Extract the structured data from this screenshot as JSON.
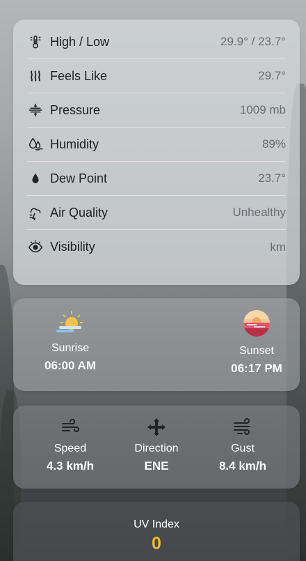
{
  "details": [
    {
      "icon": "thermometer-icon",
      "label": "High / Low",
      "value": "29.9° / 23.7°"
    },
    {
      "icon": "heat-waves-icon",
      "label": "Feels Like",
      "value": "29.7°"
    },
    {
      "icon": "pressure-icon",
      "label": "Pressure",
      "value": "1009 mb"
    },
    {
      "icon": "humidity-icon",
      "label": "Humidity",
      "value": "89%"
    },
    {
      "icon": "droplet-icon",
      "label": "Dew Point",
      "value": "23.7°"
    },
    {
      "icon": "air-quality-icon",
      "label": "Air Quality",
      "value": "Unhealthy"
    },
    {
      "icon": "eye-icon",
      "label": "Visibility",
      "value": "km"
    }
  ],
  "sun": {
    "sunrise_label": "Sunrise",
    "sunrise_time": "06:00 AM",
    "sunset_label": "Sunset",
    "sunset_time": "06:17 PM"
  },
  "wind": {
    "speed_label": "Speed",
    "speed_value": "4.3 km/h",
    "direction_label": "Direction",
    "direction_value": "ENE",
    "gust_label": "Gust",
    "gust_value": "8.4 km/h"
  },
  "uv": {
    "label": "UV Index",
    "value": "0",
    "value_color": "#f1b72c"
  }
}
